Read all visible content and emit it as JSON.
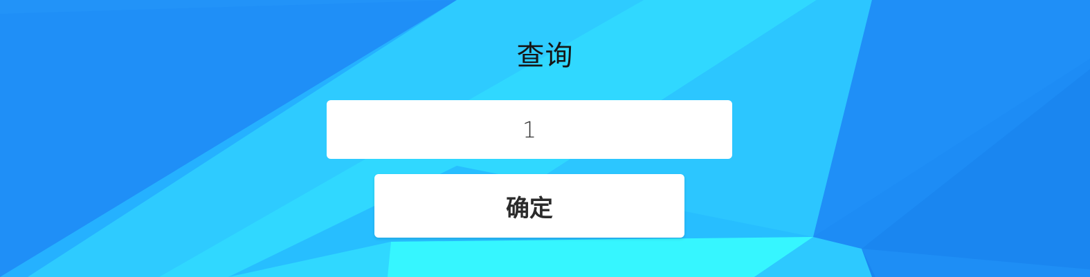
{
  "page": {
    "title": "查询"
  },
  "query_field": {
    "value": "1"
  },
  "confirm_button": {
    "label": "确定"
  },
  "colors": {
    "bg_base": "#1f8ff7",
    "bg_light": "#2ed6ff",
    "bg_cyan": "#36f6ff",
    "bg_deep": "#1a86f0"
  }
}
